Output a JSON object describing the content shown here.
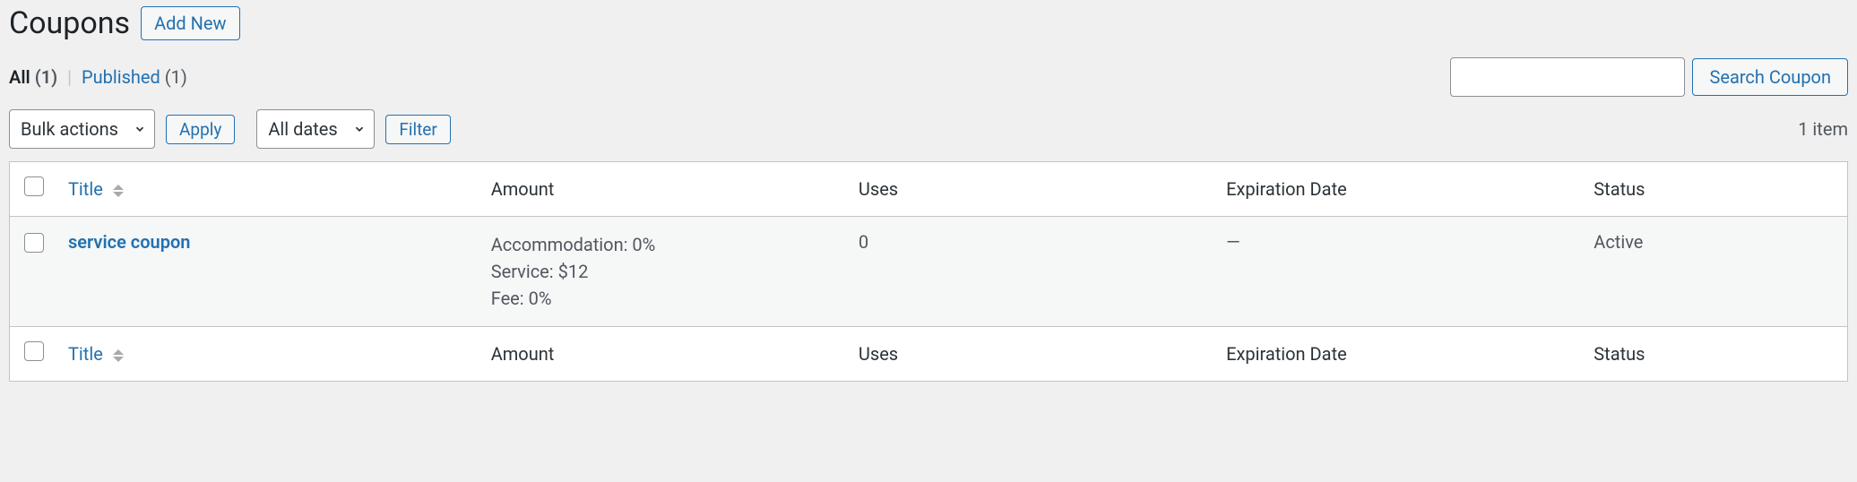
{
  "header": {
    "page_title": "Coupons",
    "add_new_label": "Add New"
  },
  "filters": {
    "all_label": "All",
    "all_count": "(1)",
    "published_label": "Published",
    "published_count": "(1)"
  },
  "search": {
    "button_label": "Search Coupon"
  },
  "bulk": {
    "bulk_actions_label": "Bulk actions",
    "apply_label": "Apply",
    "dates_label": "All dates",
    "filter_label": "Filter"
  },
  "pagination": {
    "items_label": "1 item"
  },
  "columns": {
    "title": "Title",
    "amount": "Amount",
    "uses": "Uses",
    "expiration": "Expiration Date",
    "status": "Status"
  },
  "rows": [
    {
      "title": "service coupon",
      "amount_line1": "Accommodation: 0%",
      "amount_line2": "Service: $12",
      "amount_line3": "Fee: 0%",
      "uses": "0",
      "expiration": "—",
      "status": "Active"
    }
  ]
}
